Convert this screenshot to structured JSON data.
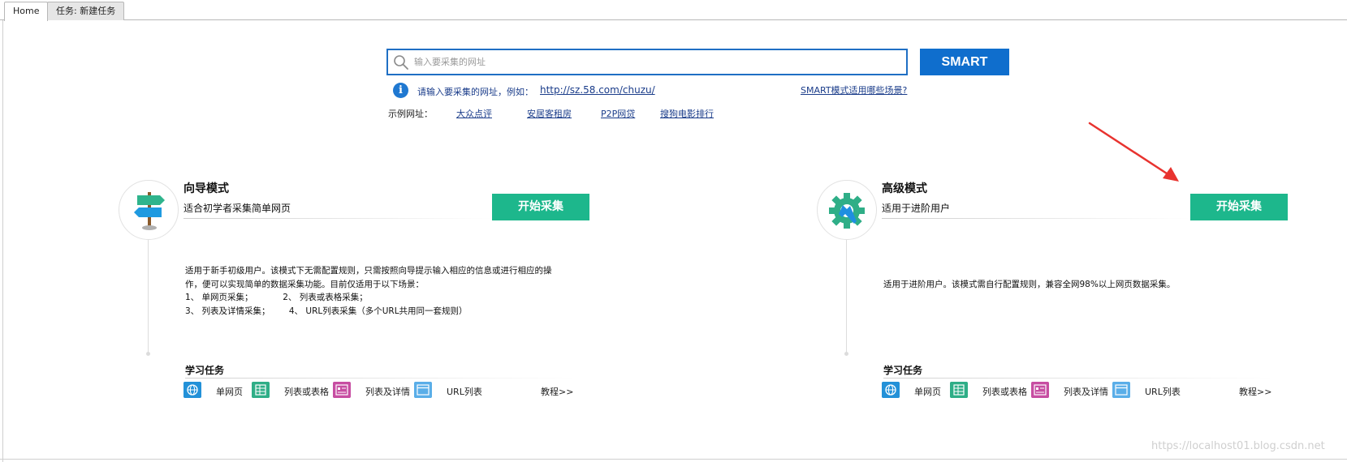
{
  "tabs": [
    {
      "label": "Home"
    },
    {
      "label": "任务: 新建任务"
    }
  ],
  "search": {
    "placeholder": "输入要采集的网址",
    "value": "",
    "button_label": "SMART",
    "hint": "请输入要采集的网址，例如：",
    "hint_example_url": "http://sz.58.com/chuzu/",
    "smart_help_link": "SMART模式适用哪些场景?"
  },
  "examples": {
    "label": "示例网址：",
    "links": [
      "大众点评",
      "安居客租房",
      "P2P网贷",
      "搜狗电影排行"
    ]
  },
  "modes": [
    {
      "title": "向导模式",
      "subtitle": "适合初学者采集简单网页",
      "button_label": "开始采集",
      "desc_lines": [
        "适用于新手初级用户。该模式下无需配置规则，只需按照向导提示输入相应的信息或进行相应的操",
        "作，便可以实现简单的数据采集功能。目前仅适用于以下场景：",
        "1、 单网页采集；           2、 列表或表格采集；",
        "3、 列表及详情采集；       4、 URL列表采集（多个URL共用同一套规则）"
      ],
      "learn_title": "学习任务",
      "tasks": [
        "单网页",
        "列表或表格",
        "列表及详情",
        "URL列表"
      ],
      "tutorial": "教程>>"
    },
    {
      "title": "高级模式",
      "subtitle": "适用于进阶用户",
      "button_label": "开始采集",
      "desc_lines": [
        "适用于进阶用户。该模式需自行配置规则，兼容全网98%以上网页数据采集。"
      ],
      "learn_title": "学习任务",
      "tasks": [
        "单网页",
        "列表或表格",
        "列表及详情",
        "URL列表"
      ],
      "tutorial": "教程>>"
    }
  ],
  "watermark": "https://localhost01.blog.csdn.net",
  "colors": {
    "accent_blue": "#0f6ecd",
    "start_green": "#1db78c",
    "link_blue": "#1a3c8a",
    "arrow_red": "#e8332f"
  }
}
